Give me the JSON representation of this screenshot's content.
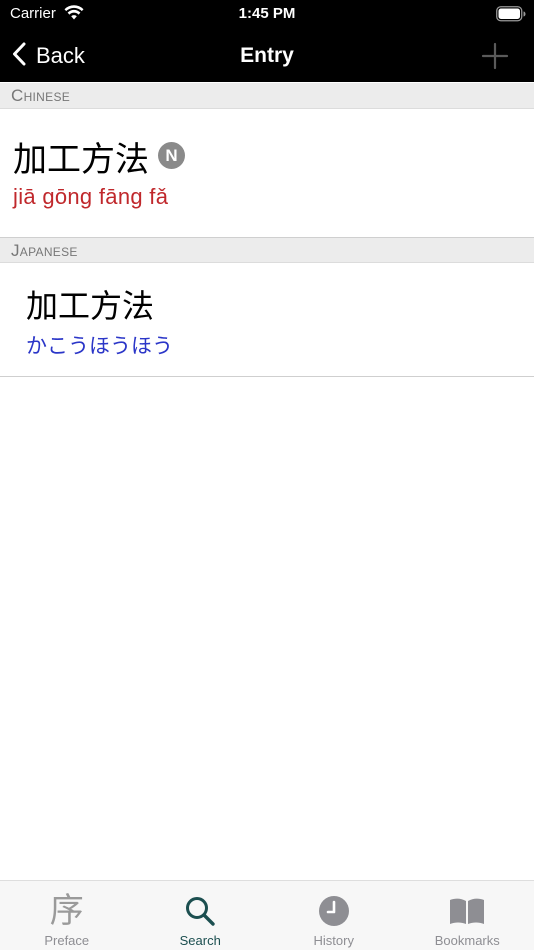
{
  "status_bar": {
    "carrier": "Carrier",
    "time": "1:45 PM"
  },
  "nav": {
    "back_label": "Back",
    "title": "Entry"
  },
  "sections": {
    "chinese_header": "Chinese",
    "japanese_header": "Japanese"
  },
  "chinese_entry": {
    "headword": "加工方法",
    "badge": "N",
    "pinyin": "jiā gōng fāng fǎ"
  },
  "japanese_entry": {
    "headword": "加工方法",
    "reading": "かこうほうほう"
  },
  "tabs": [
    {
      "label": "Preface",
      "icon": "preface-glyph-icon",
      "glyph": "序",
      "active": false
    },
    {
      "label": "Search",
      "icon": "search-icon",
      "active": true
    },
    {
      "label": "History",
      "icon": "clock-icon",
      "active": false
    },
    {
      "label": "Bookmarks",
      "icon": "book-icon",
      "active": false
    }
  ],
  "colors": {
    "pinyin": "#c0282c",
    "kana": "#2b36c8",
    "active_tab": "#1c4f50",
    "inactive_tab": "#8e8e93",
    "nav_background": "#000000"
  }
}
